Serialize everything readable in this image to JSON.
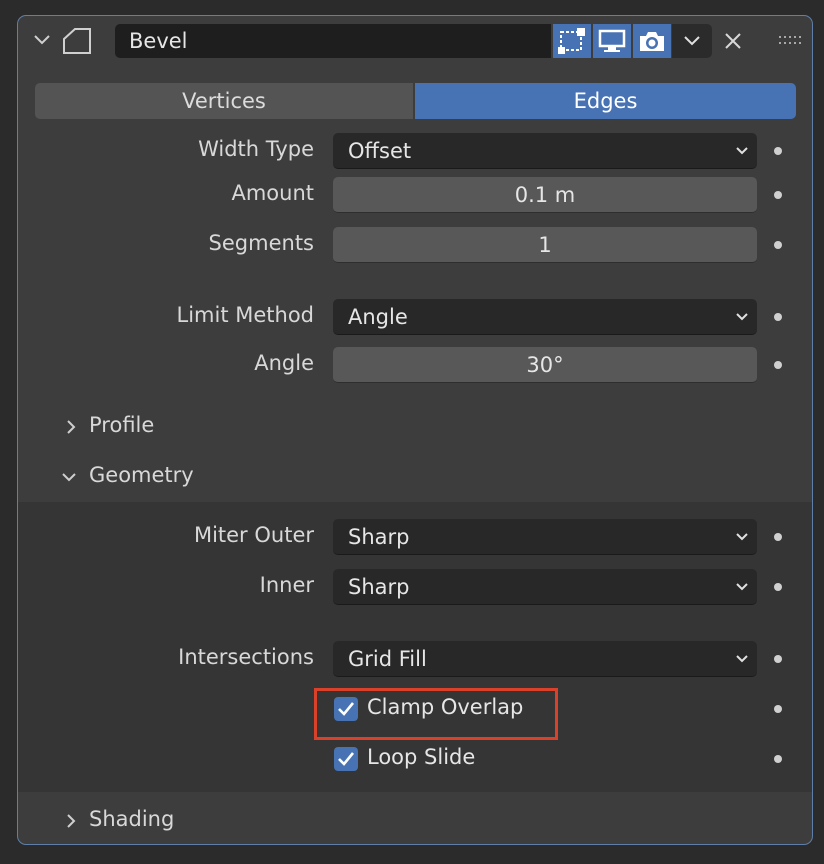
{
  "header": {
    "name_value": "Bevel"
  },
  "tabs": [
    {
      "label": "Vertices",
      "active": false
    },
    {
      "label": "Edges",
      "active": true
    }
  ],
  "fields": {
    "width_type": {
      "label": "Width Type",
      "value": "Offset"
    },
    "amount": {
      "label": "Amount",
      "value": "0.1 m"
    },
    "segments": {
      "label": "Segments",
      "value": "1"
    },
    "limit_method": {
      "label": "Limit Method",
      "value": "Angle"
    },
    "angle": {
      "label": "Angle",
      "value": "30°"
    }
  },
  "sections": {
    "profile": {
      "label": "Profile",
      "expanded": false
    },
    "geometry": {
      "label": "Geometry",
      "expanded": true
    },
    "shading": {
      "label": "Shading",
      "expanded": false
    }
  },
  "geometry": {
    "miter_outer": {
      "label": "Miter Outer",
      "value": "Sharp"
    },
    "inner": {
      "label": "Inner",
      "value": "Sharp"
    },
    "intersections": {
      "label": "Intersections",
      "value": "Grid Fill"
    },
    "clamp_overlap": {
      "label": "Clamp Overlap",
      "checked": true
    },
    "loop_slide": {
      "label": "Loop Slide",
      "checked": true
    }
  },
  "colors": {
    "accent": "#4772b3",
    "highlight_box": "#d9412a",
    "panel_bg": "#3d3d3d"
  },
  "icons": [
    "chevron-down-icon",
    "bevel-modifier-icon",
    "edit-mode-icon",
    "viewport-display-icon",
    "render-camera-icon",
    "close-icon",
    "drag-grip-icon",
    "chevron-right-icon",
    "checkmark-icon",
    "keyframe-dot-icon"
  ]
}
